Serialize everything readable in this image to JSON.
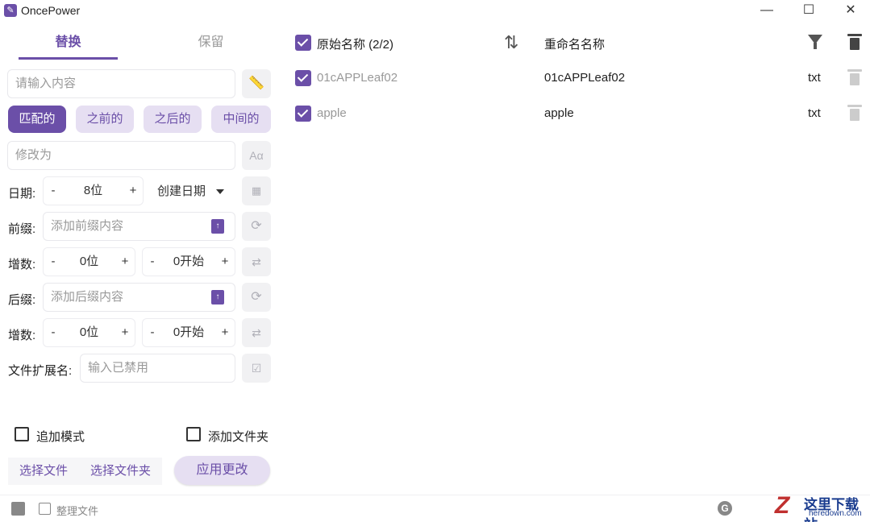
{
  "app": {
    "title": "OncePower"
  },
  "window": {
    "min": "—",
    "max": "☐",
    "close": "✕"
  },
  "tabs": {
    "replace": "替换",
    "keep": "保留"
  },
  "search": {
    "placeholder": "请输入内容"
  },
  "modes": [
    "匹配的",
    "之前的",
    "之后的",
    "中间的"
  ],
  "modify": {
    "placeholder": "修改为",
    "btn": "Aα"
  },
  "date": {
    "label": "日期:",
    "minus": "-",
    "value": "8位",
    "plus": "+",
    "dropdown": "创建日期"
  },
  "prefix": {
    "label": "前缀:",
    "placeholder": "添加前缀内容"
  },
  "increment1": {
    "label": "增数:",
    "digits": "0位",
    "start": "0开始"
  },
  "suffix": {
    "label": "后缀:",
    "placeholder": "添加后缀内容"
  },
  "increment2": {
    "label": "增数:",
    "digits": "0位",
    "start": "0开始"
  },
  "extension": {
    "label": "文件扩展名:",
    "placeholder": "输入已禁用"
  },
  "options": {
    "append_mode": "追加模式",
    "add_folder": "添加文件夹"
  },
  "actions": {
    "select_file": "选择文件",
    "select_folder": "选择文件夹",
    "apply": "应用更改"
  },
  "footer": {
    "organize": "整理文件",
    "g": "G"
  },
  "list": {
    "header_original": "原始名称 (2/2)",
    "header_renamed": "重命名名称",
    "rows": [
      {
        "original": "01cAPPLeaf02",
        "renamed": "01cAPPLeaf02",
        "ext": "txt"
      },
      {
        "original": "apple",
        "renamed": "apple",
        "ext": "txt"
      }
    ]
  },
  "watermark": {
    "logo": "Z",
    "title": "这里下载站",
    "sub": "heredown.com"
  },
  "colors": {
    "accent": "#6b4fa8",
    "accent_light": "#e6dff2"
  }
}
